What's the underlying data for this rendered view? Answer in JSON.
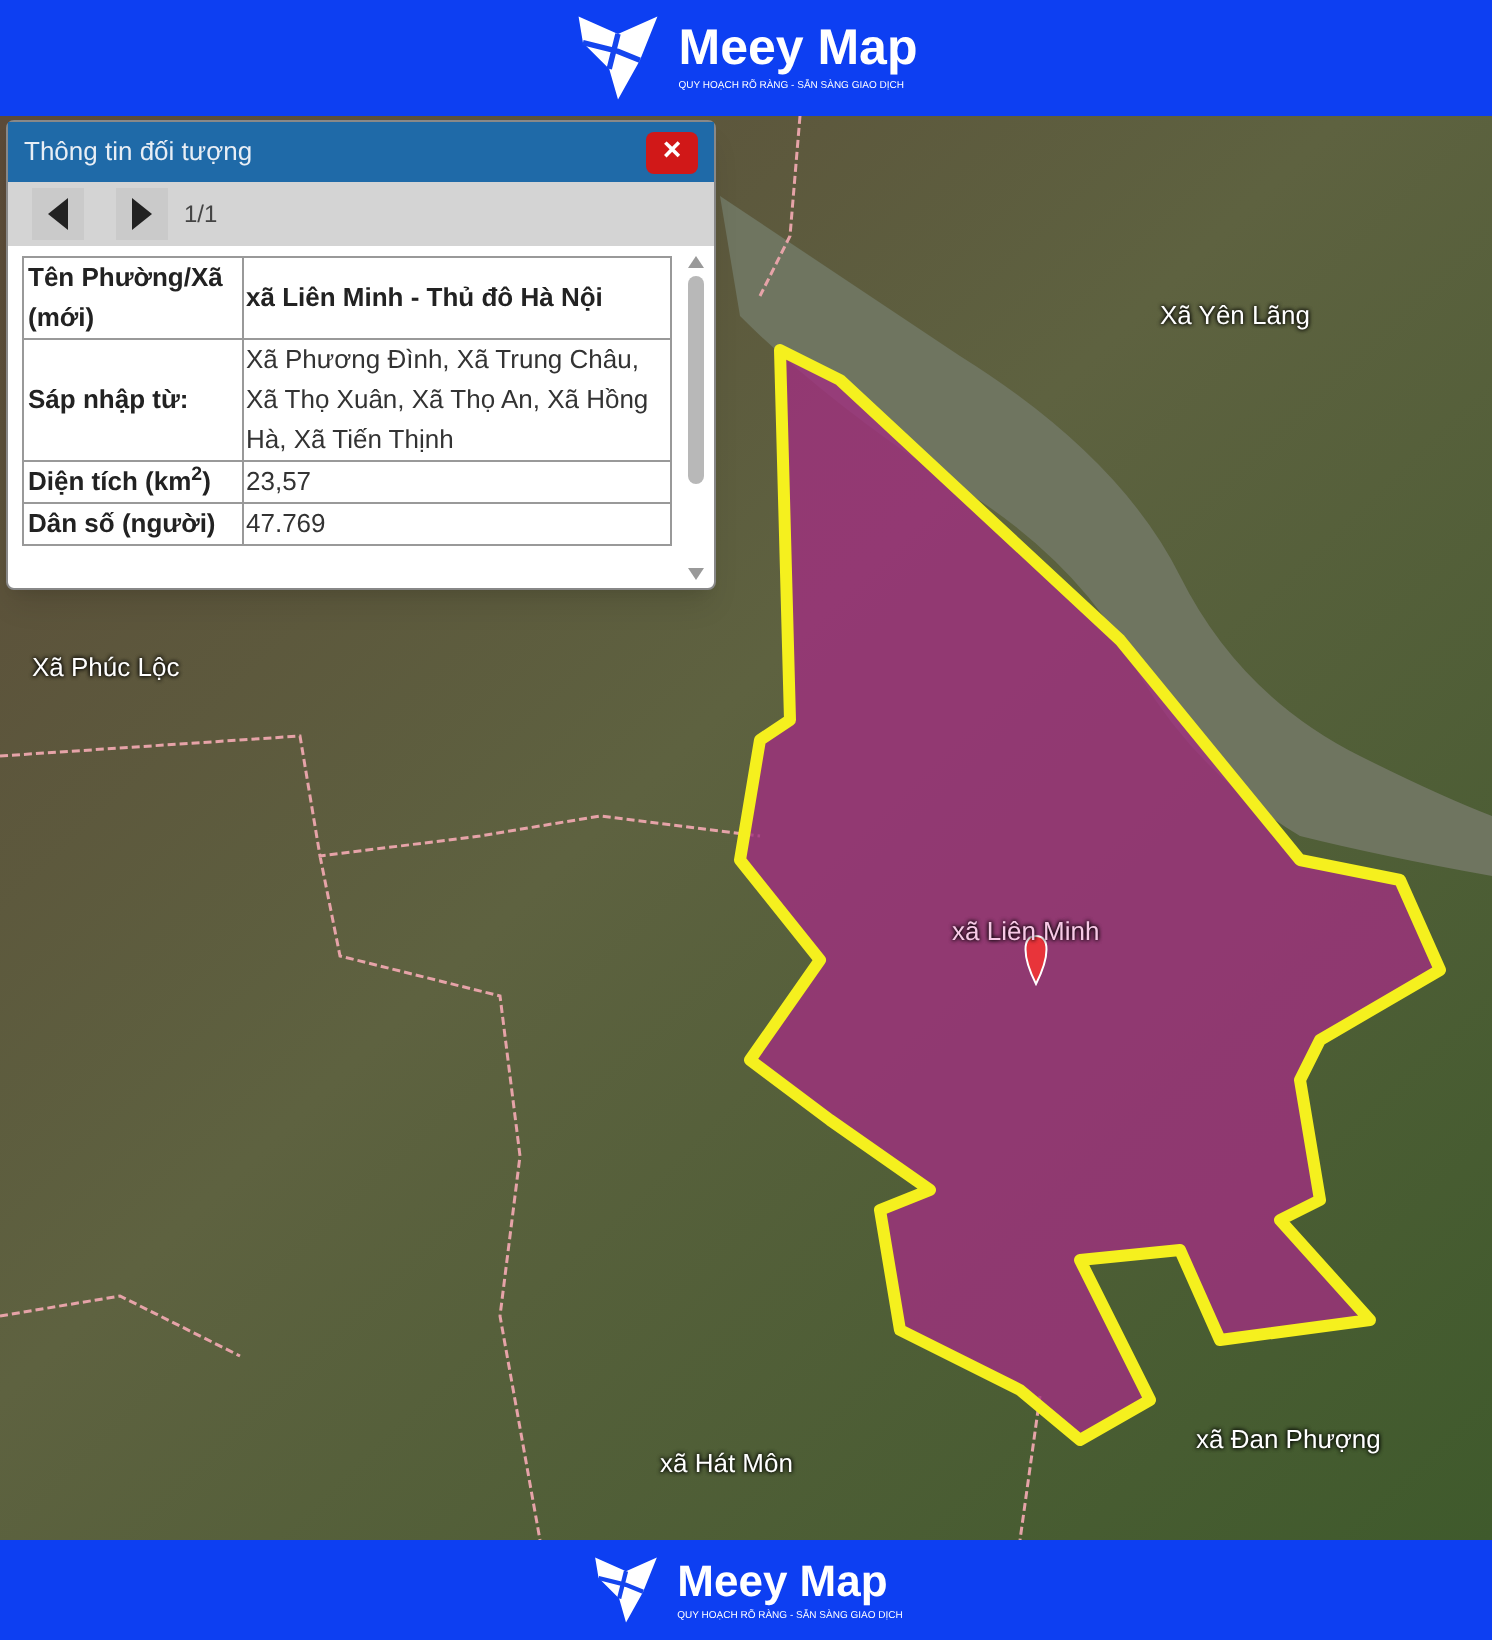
{
  "header": {
    "brand": "Meey Map",
    "tagline": "QUY HOẠCH RÕ RÀNG - SẴN SÀNG GIAO DỊCH"
  },
  "popup": {
    "title": "Thông tin đối tượng",
    "close": "×",
    "pager": "1/1",
    "rows": [
      {
        "label": "Tên Phường/Xã (mới)",
        "value": "xã Liên Minh - Thủ đô Hà Nội",
        "kind": "bold"
      },
      {
        "label": "Sáp nhập từ:",
        "value": "Xã Phương Đình, Xã Trung Châu, Xã Thọ Xuân, Xã Thọ An, Xã Hồng Hà, Xã Tiến Thịnh",
        "kind": "plain"
      },
      {
        "label": "Diện tích (km$^{2}$)",
        "value": "23,57",
        "kind": "plain"
      },
      {
        "label": "Dân số (người)",
        "value": "47.769",
        "kind": "plain"
      }
    ]
  },
  "map": {
    "labels": [
      {
        "text": "Xã Yên Lãng",
        "kind": "place"
      },
      {
        "text": "Xã Phúc Lộc",
        "kind": "place"
      },
      {
        "text": "xã Liên Minh",
        "kind": "selected"
      },
      {
        "text": "xã Hát Môn",
        "kind": "place"
      },
      {
        "text": "xã Đan Phượng",
        "kind": "place"
      }
    ]
  },
  "footer": {
    "brand": "Meey Map",
    "tagline": "QUY HOẠCH RÕ RÀNG - SẴN SÀNG GIAO DỊCH"
  }
}
